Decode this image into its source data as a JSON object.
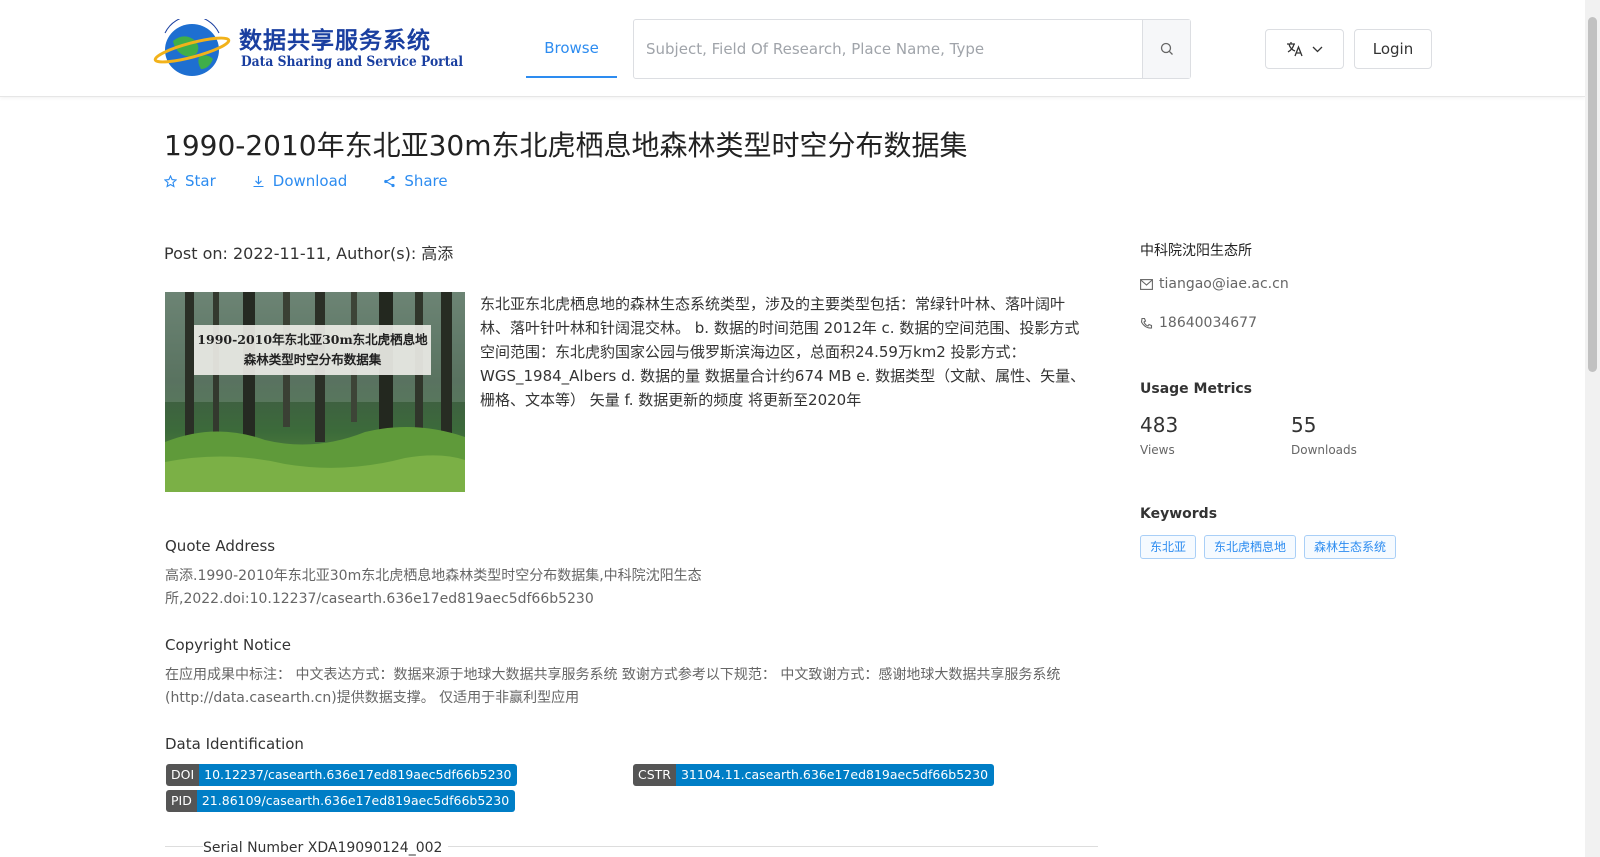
{
  "header": {
    "logo_cn": "数据共享服务系统",
    "logo_en": "Data Sharing and Service Portal",
    "nav_browse": "Browse",
    "search_placeholder": "Subject, Field Of Research, Place Name, Type",
    "login": "Login"
  },
  "dataset": {
    "title": "1990-2010年东北亚30m东北虎栖息地森林类型时空分布数据集",
    "actions": {
      "star": "Star",
      "download": "Download",
      "share": "Share"
    },
    "post_on": "Post on: 2022-11-11, Author(s): 高添",
    "cover_text_line1": "1990-2010年东北亚30m东北虎栖息地",
    "cover_text_line2": "森林类型时空分布数据集",
    "description": "东北亚东北虎栖息地的森林生态系统类型，涉及的主要类型包括：常绿针叶林、落叶阔叶林、落叶针叶林和针阔混交林。 b. 数据的时间范围 2012年 c. 数据的空间范围、投影方式 空间范围：东北虎豹国家公园与俄罗斯滨海边区，总面积24.59万km2 投影方式：WGS_1984_Albers d. 数据的量 数据量合计约674 MB e. 数据类型（文献、属性、矢量、栅格、文本等） 矢量 f. 数据更新的频度 将更新至2020年"
  },
  "quote": {
    "heading": "Quote Address",
    "text": "高添.1990-2010年东北亚30m东北虎栖息地森林类型时空分布数据集,中科院沈阳生态所,2022.doi:10.12237/casearth.636e17ed819aec5df66b5230"
  },
  "copyright": {
    "heading": "Copyright Notice",
    "text": "在应用成果中标注： 中文表达方式：数据来源于地球大数据共享服务系统 致谢方式参考以下规范： 中文致谢方式：感谢地球大数据共享服务系统(http://data.casearth.cn)提供数据支撑。 仅适用于非赢利型应用"
  },
  "identification": {
    "heading": "Data Identification",
    "doi_key": "DOI",
    "doi_value": "10.12237/casearth.636e17ed819aec5df66b5230",
    "cstr_key": "CSTR",
    "cstr_value": "31104.11.casearth.636e17ed819aec5df66b5230",
    "pid_key": "PID",
    "pid_value": "21.86109/casearth.636e17ed819aec5df66b5230"
  },
  "serial": "Serial Number XDA19090124_002",
  "sidebar": {
    "org": "中科院沈阳生态所",
    "email": "tiangao@iae.ac.cn",
    "phone": "18640034677",
    "metrics_heading": "Usage Metrics",
    "views_value": "483",
    "views_label": "Views",
    "downloads_value": "55",
    "downloads_label": "Downloads",
    "keywords_heading": "Keywords",
    "keywords": [
      "东北亚",
      "东北虎栖息地",
      "森林生态系统"
    ]
  },
  "colors": {
    "accent": "#2d8cf0",
    "badge_key": "#555555",
    "badge_value": "#007ec6"
  }
}
